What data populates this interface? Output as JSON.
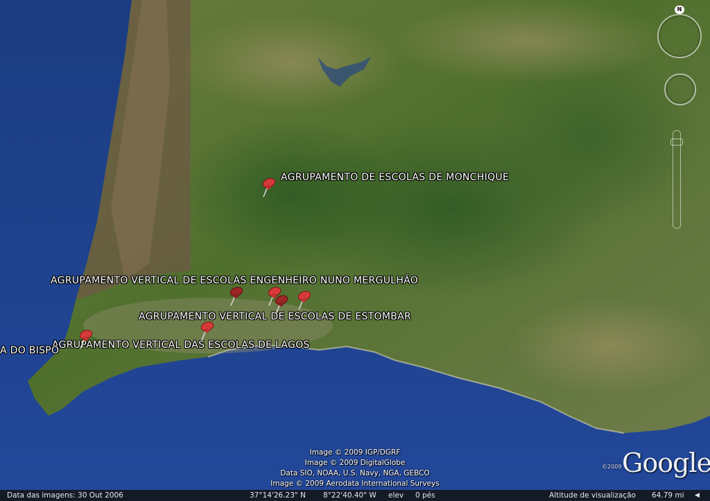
{
  "map": {
    "placemarks": [
      {
        "name": "AGRUPAMENTO DE ESCOLAS DE MONCHIQUE"
      },
      {
        "name": "AGRUPAMENTO VERTICAL DE ESCOLAS ENGENHEIRO NUNO MERGULHÃO"
      },
      {
        "name": "AGRUPAMENTO VERTICAL DE ESCOLAS DE ESTOMBAR"
      },
      {
        "name": "AGRUPAMENTO VERTICAL DAS ESCOLAS DE LAGOS"
      },
      {
        "name": "A DO BISPO"
      }
    ]
  },
  "attribution": [
    "Image © 2009 IGP/DGRF",
    "Image © 2009 DigitalGlobe",
    "Data SIO, NOAA, U.S. Navy, NGA, GEBCO",
    "Image © 2009 Aerodata International Surveys"
  ],
  "logo": {
    "copyright": "©2009",
    "text": "Google"
  },
  "navigation": {
    "north": "N"
  },
  "status": {
    "imagery_date": "Data das imagens: 30 Out 2006",
    "latitude": "37°14'26.23\" N",
    "longitude": "8°22'40.40\" W",
    "elev_label": "elev",
    "elev_value": "0 pés",
    "eye_alt_label": "Altitude de visualização",
    "eye_alt_value": "64.79 mi"
  },
  "colors": {
    "sea": "#1d3f86",
    "land": "#5f7a38",
    "pin": "#d83a3a",
    "statusbar": "#141a26"
  }
}
